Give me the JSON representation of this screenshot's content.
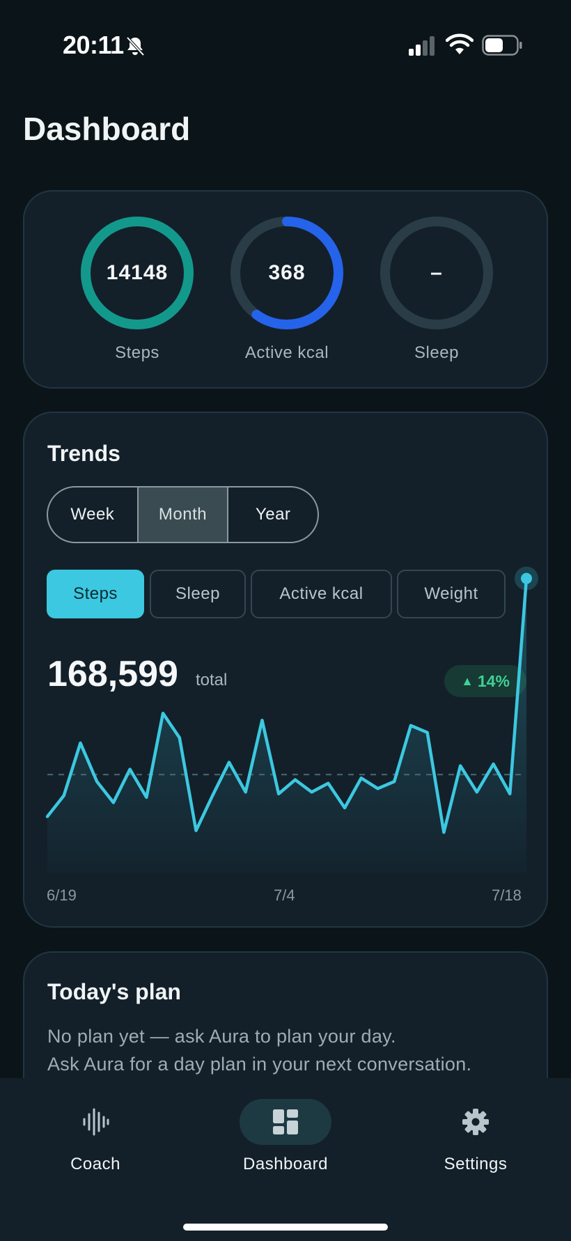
{
  "status_bar": {
    "time": "20:11"
  },
  "page": {
    "title": "Dashboard"
  },
  "summary": {
    "rings": [
      {
        "label": "Steps",
        "value": "14148",
        "progress": 1.0,
        "color": "#13998c"
      },
      {
        "label": "Active kcal",
        "value": "368",
        "progress": 0.6,
        "color": "#2563eb"
      },
      {
        "label": "Sleep",
        "value": "–",
        "progress": 0,
        "color": "#2a3d46"
      }
    ]
  },
  "trends": {
    "title": "Trends",
    "ranges": [
      "Week",
      "Month",
      "Year"
    ],
    "selected_range": "Month",
    "metrics": [
      "Steps",
      "Sleep",
      "Active kcal",
      "Weight"
    ],
    "selected_metric": "Steps",
    "total": "168,599",
    "total_unit": "total",
    "delta": "14%",
    "accent": "#3cc8e0"
  },
  "chart_data": {
    "type": "area",
    "x": [
      "6/19",
      "6/20",
      "6/21",
      "6/22",
      "6/23",
      "6/24",
      "6/25",
      "6/26",
      "6/27",
      "6/28",
      "6/29",
      "6/30",
      "7/1",
      "7/2",
      "7/3",
      "7/4",
      "7/5",
      "7/6",
      "7/7",
      "7/8",
      "7/9",
      "7/10",
      "7/11",
      "7/12",
      "7/13",
      "7/14",
      "7/15",
      "7/16",
      "7/17",
      "7/18"
    ],
    "x_tick_labels": [
      "6/19",
      "7/4",
      "7/18"
    ],
    "values": [
      3200,
      4400,
      7400,
      5200,
      4000,
      5900,
      4300,
      9100,
      7700,
      2400,
      4400,
      6300,
      4600,
      8700,
      4500,
      5300,
      4600,
      5100,
      3700,
      5400,
      4800,
      5200,
      8400,
      8000,
      2300,
      6100,
      4600,
      6200,
      4500,
      16800
    ],
    "average": 5600,
    "ylim": [
      0,
      17500
    ],
    "xlabel": "",
    "ylabel": ""
  },
  "plan": {
    "title": "Today's plan",
    "line1": "No plan yet — ask Aura to plan your day.",
    "line2": "Ask Aura for a day plan in your next conversation."
  },
  "nav": {
    "items": [
      {
        "label": "Coach",
        "icon": "waveform-icon"
      },
      {
        "label": "Dashboard",
        "icon": "dashboard-grid-icon"
      },
      {
        "label": "Settings",
        "icon": "gear-icon"
      }
    ],
    "active": "Dashboard"
  }
}
